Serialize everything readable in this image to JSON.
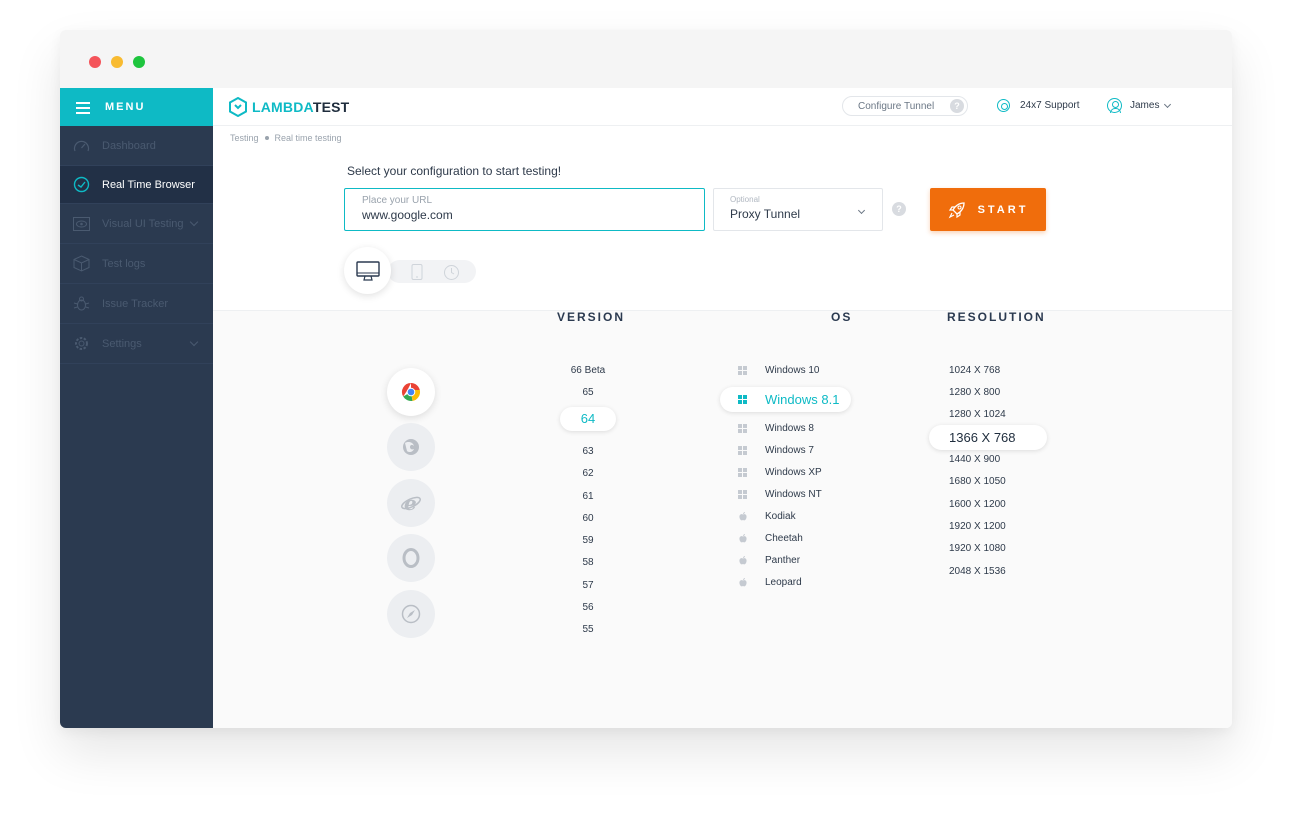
{
  "window": {
    "controls": [
      "close",
      "minimize",
      "maximize"
    ]
  },
  "sidebar": {
    "menu_label": "MENU",
    "items": [
      {
        "label": "Dashboard",
        "icon": "speedometer-icon",
        "active": false
      },
      {
        "label": "Real Time Browser",
        "icon": "refresh-clock-icon",
        "active": true
      },
      {
        "label": "Visual UI Testing",
        "icon": "eye-screen-icon",
        "active": false,
        "expandable": true
      },
      {
        "label": "Test logs",
        "icon": "box-icon",
        "active": false
      },
      {
        "label": "Issue Tracker",
        "icon": "bug-icon",
        "active": false
      },
      {
        "label": "Settings",
        "icon": "gear-icon",
        "active": false,
        "expandable": true
      }
    ]
  },
  "header": {
    "logo_part1": "LAMBDA",
    "logo_part2": "TEST",
    "configure_tunnel": "Configure Tunnel",
    "help": "?",
    "support": "24x7 Support",
    "user": "James"
  },
  "breadcrumb": {
    "parent": "Testing",
    "current": "Real time testing"
  },
  "config": {
    "prompt": "Select your configuration to start testing!",
    "url_placeholder": "Place your URL",
    "url_value": "www.google.com",
    "proxy_optional": "Optional",
    "proxy_value": "Proxy Tunnel",
    "help": "?",
    "start_label": "START"
  },
  "columns": {
    "version": "VERSION",
    "os": "OS",
    "resolution": "RESOLUTION"
  },
  "devices": [
    "desktop-icon",
    "mobile-icon",
    "clock-icon"
  ],
  "browsers": [
    {
      "name": "chrome",
      "selected": true
    },
    {
      "name": "firefox",
      "selected": false
    },
    {
      "name": "ie",
      "selected": false
    },
    {
      "name": "opera",
      "selected": false
    },
    {
      "name": "safari",
      "selected": false
    }
  ],
  "versions": [
    "66 Beta",
    "65",
    "64",
    "63",
    "62",
    "61",
    "60",
    "59",
    "58",
    "57",
    "56",
    "55"
  ],
  "selected_version": "64",
  "os_list": [
    {
      "name": "Windows 10",
      "family": "windows"
    },
    {
      "name": "Windows 8.1",
      "family": "windows",
      "selected": true
    },
    {
      "name": "Windows 8",
      "family": "windows"
    },
    {
      "name": "Windows 7",
      "family": "windows"
    },
    {
      "name": "Windows XP",
      "family": "windows"
    },
    {
      "name": "Windows NT",
      "family": "windows"
    },
    {
      "name": "Kodiak",
      "family": "apple"
    },
    {
      "name": "Cheetah",
      "family": "apple"
    },
    {
      "name": "Panther",
      "family": "apple"
    },
    {
      "name": "Leopard",
      "family": "apple"
    }
  ],
  "resolutions": [
    "1024 X 768",
    "1280 X 800",
    "1280 X 1024",
    "1366 X 768",
    "1440 X 900",
    "1680 X 1050",
    "1600 X 1200",
    "1920 X 1200",
    "1920 X 1080",
    "2048 X 1536"
  ],
  "selected_resolution": "1366 X 768",
  "colors": {
    "accent": "#0ebac5",
    "start": "#f06d0c",
    "sidebar": "#2b3a50"
  }
}
